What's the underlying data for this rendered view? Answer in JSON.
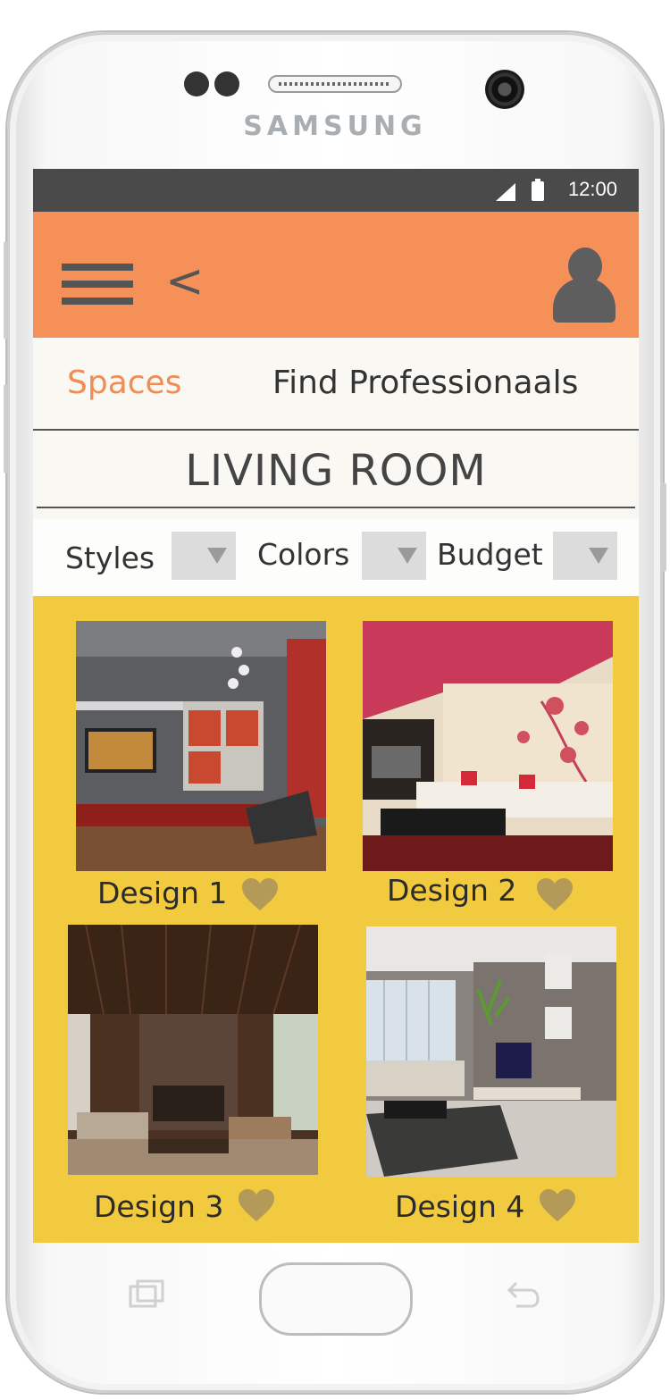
{
  "device": {
    "brand": "SAMSUNG"
  },
  "status_bar": {
    "time": "12:00"
  },
  "app_bar": {
    "back_label": "<"
  },
  "tabs": [
    {
      "label": "Spaces",
      "active": true
    },
    {
      "label": "Find Professionaals",
      "active": false
    }
  ],
  "page_title": "LIVING ROOM",
  "filters": [
    {
      "label": "Styles"
    },
    {
      "label": "Colors"
    },
    {
      "label": "Budget"
    }
  ],
  "designs": [
    {
      "label": "Design 1"
    },
    {
      "label": "Design 2"
    },
    {
      "label": "Design 3"
    },
    {
      "label": "Design 4"
    }
  ],
  "colors": {
    "app_bar": "#f59058",
    "active_tab": "#f08c54",
    "gallery_background": "#f1ca40",
    "status_bar": "#4a4a4a",
    "heart": "#b39a58"
  }
}
